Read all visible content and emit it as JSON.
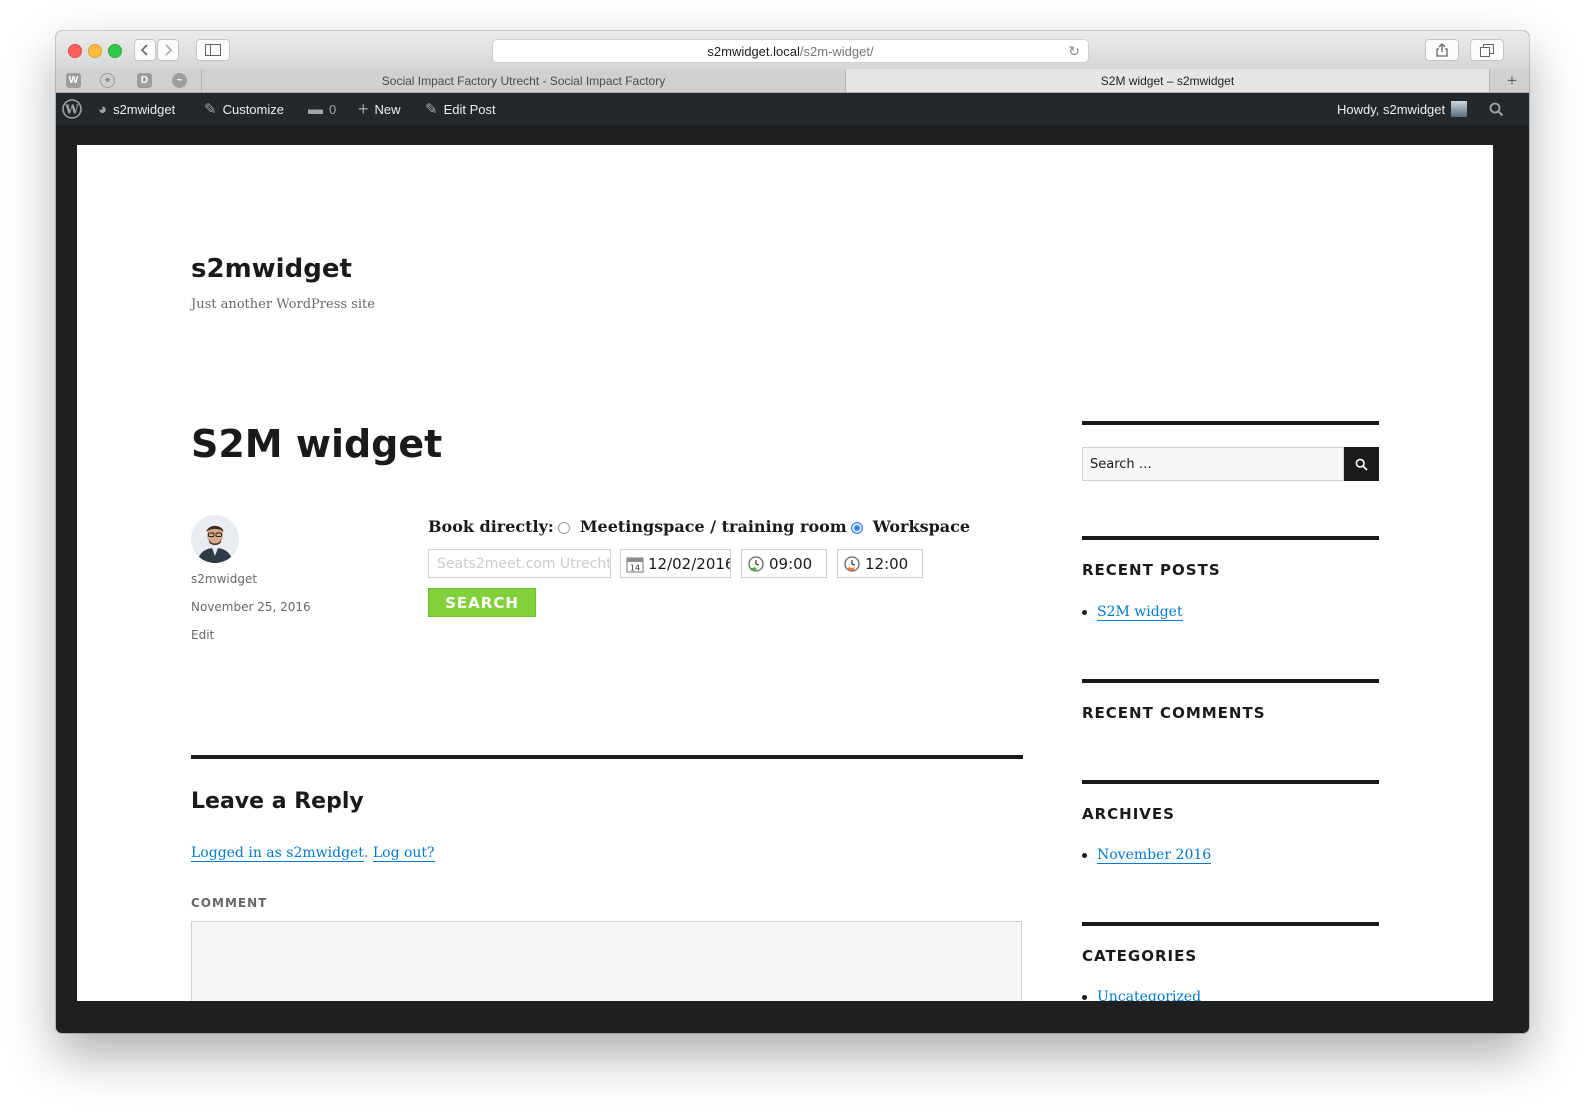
{
  "browser": {
    "url_host": "s2mwidget.local",
    "url_path": "/s2m-widget/",
    "tabs": [
      {
        "label": "Social Impact Factory Utrecht - Social Impact Factory"
      },
      {
        "label": "S2M widget – s2mwidget"
      }
    ],
    "favorites": [
      "W",
      "D"
    ]
  },
  "admin_bar": {
    "site_name": "s2mwidget",
    "customize": "Customize",
    "comments_count": "0",
    "new": "New",
    "edit_post": "Edit Post",
    "howdy": "Howdy, s2mwidget"
  },
  "site": {
    "title": "s2mwidget",
    "description": "Just another WordPress site"
  },
  "post": {
    "title": "S2M widget",
    "author": "s2mwidget",
    "date": "November 25, 2016",
    "edit_link": "Edit"
  },
  "widget": {
    "book_label": "Book directly:",
    "options": [
      {
        "label": "Meetingspace / training room",
        "checked": false
      },
      {
        "label": "Workspace",
        "checked": true
      }
    ],
    "location_placeholder": "Seats2meet.com Utrecht",
    "date": "12/02/2016",
    "start_time": "09:00",
    "end_time": "12:00",
    "search_button": "SEARCH",
    "button_color": "#82d13c"
  },
  "comments": {
    "title": "Leave a Reply",
    "logged_in_text": "Logged in as s2mwidget",
    "logout_text": "Log out?",
    "comment_label": "COMMENT"
  },
  "sidebar": {
    "search_placeholder": "Search …",
    "recent_posts_title": "RECENT POSTS",
    "recent_posts": [
      "S2M widget"
    ],
    "recent_comments_title": "RECENT COMMENTS",
    "archives_title": "ARCHIVES",
    "archives": [
      "November 2016"
    ],
    "categories_title": "CATEGORIES",
    "categories": [
      "Uncategorized"
    ]
  },
  "colors": {
    "admin_bar": "#23282d",
    "link": "#007acc",
    "text": "#1a1a1a"
  }
}
